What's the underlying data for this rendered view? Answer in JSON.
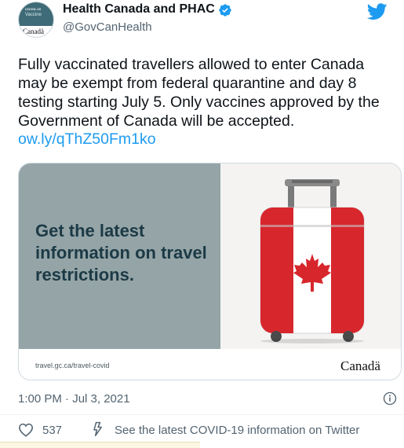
{
  "author": {
    "display_name": "Health Canada and PHAC",
    "handle": "@GovCanHealth",
    "avatar": {
      "covid_text": "COVID-19",
      "vaccine_text": "Vaccine",
      "wordmark": "Canadä"
    },
    "verified_icon": "verified-badge-icon"
  },
  "brand_icon": "twitter-bird-icon",
  "tweet": {
    "text": "Fully vaccinated travellers allowed to enter Canada may be exempt from federal quarantine and day 8 testing starting July 5. Only vaccines approved by the Government of Canada will be accepted.",
    "link": "ow.ly/qThZ50Fm1ko"
  },
  "card": {
    "headline": "Get the latest information on travel restrictions.",
    "url": "travel.gc.ca/travel-covid",
    "wordmark": "Canadä",
    "image": "canada-flag-suitcase"
  },
  "timestamp": "1:00 PM · Jul 3, 2021",
  "actions": {
    "like_count": "537",
    "info_link": "See the latest COVID-19 information on Twitter"
  },
  "colors": {
    "accent": "#1d9bf0",
    "card_left_bg": "#94a4a7",
    "headline": "#1c3a45",
    "flag_red": "#d8262d"
  }
}
